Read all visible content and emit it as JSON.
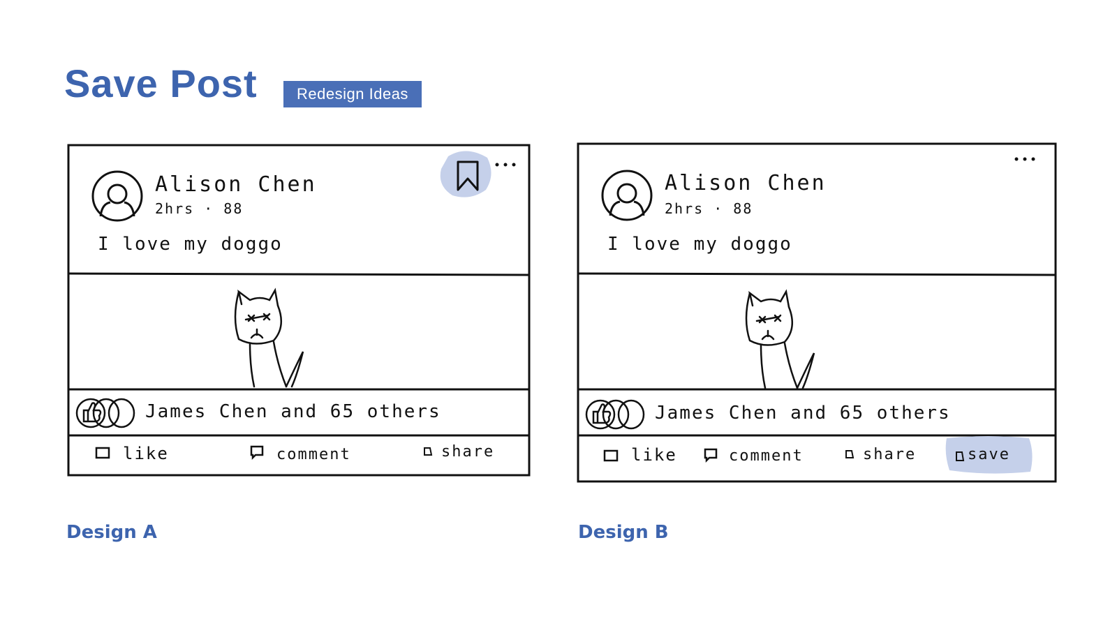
{
  "header": {
    "title": "Save Post",
    "badge": "Redesign Ideas"
  },
  "colors": {
    "accent": "#3d64ae",
    "badge_bg": "#4a6fb7",
    "highlight": "#c5d0ea",
    "ink": "#111111"
  },
  "designs": [
    {
      "caption": "Design A",
      "post": {
        "author": "Alison Chen",
        "meta": "2hrs · 88",
        "text": "I love my doggo",
        "reactions_text": "James Chen and 65 others",
        "actions": {
          "like": "like",
          "comment": "comment",
          "share": "share"
        }
      },
      "icons": [
        "save-bookmark-icon",
        "more-options-icon",
        "avatar-icon",
        "cat-drawing",
        "like-reaction-icon"
      ]
    },
    {
      "caption": "Design B",
      "post": {
        "author": "Alison Chen",
        "meta": "2hrs · 88",
        "text": "I love my doggo",
        "reactions_text": "James Chen and 65 others",
        "actions": {
          "like": "like",
          "comment": "comment",
          "share": "share",
          "save": "save"
        }
      },
      "icons": [
        "more-options-icon",
        "avatar-icon",
        "cat-drawing",
        "like-reaction-icon"
      ]
    }
  ]
}
